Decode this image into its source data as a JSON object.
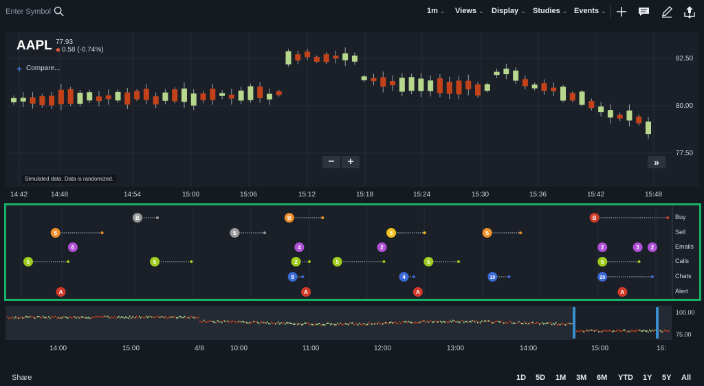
{
  "toolbar": {
    "symbol_placeholder": "Enter Symbol",
    "menus": [
      {
        "label": "1m",
        "name": "interval"
      },
      {
        "label": "Views",
        "name": "views"
      },
      {
        "label": "Display",
        "name": "display"
      },
      {
        "label": "Studies",
        "name": "studies"
      },
      {
        "label": "Events",
        "name": "events"
      }
    ],
    "tools": [
      "plus-icon",
      "comment-icon",
      "pencil-icon",
      "share-export-icon"
    ]
  },
  "ticker": {
    "symbol": "AAPL",
    "price": "77.93",
    "change": "0.58 (-0.74%)",
    "compare_label": "Compare...",
    "disclaimer": "Simulated data. Data is randomized."
  },
  "colors": {
    "up": "#b6d78c",
    "down": "#c4421a",
    "accent": "#17b26a",
    "compare": "#3a7bd5"
  },
  "main_chart": {
    "yaxis_labels": [
      "82.50",
      "80.00",
      "77.50"
    ],
    "xaxis_labels": [
      "14:42",
      "14:48",
      "14:54",
      "15:00",
      "15:06",
      "15:12",
      "15:18",
      "15:24",
      "15:30",
      "15:36",
      "15:42",
      "15:48"
    ],
    "zoom_out": "−",
    "zoom_in": "+",
    "scroll_label": "»"
  },
  "events_panel": {
    "rows": [
      "Buy",
      "Sell",
      "Emails",
      "Calls",
      "Chats",
      "Alert"
    ],
    "markers": [
      {
        "row": 0,
        "label": "B",
        "color": "#9a9a9a",
        "t": 0.197,
        "tail": 0.03
      },
      {
        "row": 0,
        "label": "B",
        "color": "#f0902a",
        "t": 0.425,
        "tail": 0.05
      },
      {
        "row": 0,
        "label": "B",
        "color": "#d23b2a",
        "t": 0.883,
        "tail": 0.11
      },
      {
        "row": 1,
        "label": "S",
        "color": "#f0902a",
        "t": 0.074,
        "tail": 0.07
      },
      {
        "row": 1,
        "label": "S",
        "color": "#9a9a9a",
        "t": 0.343,
        "tail": 0.045
      },
      {
        "row": 1,
        "label": "S",
        "color": "#f2c11b",
        "t": 0.578,
        "tail": 0.05
      },
      {
        "row": 1,
        "label": "S",
        "color": "#f0902a",
        "t": 0.722,
        "tail": 0.05
      },
      {
        "row": 2,
        "label": "6",
        "color": "#b050d6",
        "t": 0.1,
        "tail": 0
      },
      {
        "row": 2,
        "label": "4",
        "color": "#b050d6",
        "t": 0.44,
        "tail": 0
      },
      {
        "row": 2,
        "label": "2",
        "color": "#b050d6",
        "t": 0.564,
        "tail": 0
      },
      {
        "row": 2,
        "label": "2",
        "color": "#b050d6",
        "t": 0.895,
        "tail": 0
      },
      {
        "row": 2,
        "label": "3",
        "color": "#b050d6",
        "t": 0.948,
        "tail": 0
      },
      {
        "row": 2,
        "label": "2",
        "color": "#b050d6",
        "t": 0.97,
        "tail": 0
      },
      {
        "row": 3,
        "label": "5",
        "color": "#9ccc1c",
        "t": 0.033,
        "tail": 0.06
      },
      {
        "row": 3,
        "label": "5",
        "color": "#9ccc1c",
        "t": 0.223,
        "tail": 0.055
      },
      {
        "row": 3,
        "label": "2",
        "color": "#9ccc1c",
        "t": 0.435,
        "tail": 0.02
      },
      {
        "row": 3,
        "label": "5",
        "color": "#9ccc1c",
        "t": 0.497,
        "tail": 0.07
      },
      {
        "row": 3,
        "label": "5",
        "color": "#9ccc1c",
        "t": 0.634,
        "tail": 0.045
      },
      {
        "row": 3,
        "label": "5",
        "color": "#9ccc1c",
        "t": 0.895,
        "tail": 0.055
      },
      {
        "row": 4,
        "label": "8",
        "color": "#3b69d6",
        "t": 0.43,
        "tail": 0.015
      },
      {
        "row": 4,
        "label": "4",
        "color": "#3b69d6",
        "t": 0.597,
        "tail": 0.015
      },
      {
        "row": 4,
        "label": "10",
        "color": "#3b69d6",
        "t": 0.73,
        "tail": 0.025
      },
      {
        "row": 4,
        "label": "20",
        "color": "#3b69d6",
        "t": 0.895,
        "tail": 0.075
      },
      {
        "row": 5,
        "label": "A",
        "color": "#d23b2a",
        "t": 0.082,
        "tail": 0
      },
      {
        "row": 5,
        "label": "A",
        "color": "#d23b2a",
        "t": 0.45,
        "tail": 0
      },
      {
        "row": 5,
        "label": "A",
        "color": "#d23b2a",
        "t": 0.618,
        "tail": 0
      },
      {
        "row": 5,
        "label": "A",
        "color": "#d23b2a",
        "t": 0.925,
        "tail": 0
      }
    ]
  },
  "overview": {
    "yaxis_labels": [
      "100.00",
      "75.00"
    ],
    "xaxis_labels": [
      "14:00",
      "15:00",
      "4/8",
      "10:00",
      "11:00",
      "12:00",
      "13:00",
      "14:00",
      "15:00",
      "16:"
    ]
  },
  "bottom": {
    "share_label": "Share",
    "ranges": [
      "1D",
      "5D",
      "1M",
      "3M",
      "6M",
      "YTD",
      "1Y",
      "5Y",
      "All"
    ]
  }
}
